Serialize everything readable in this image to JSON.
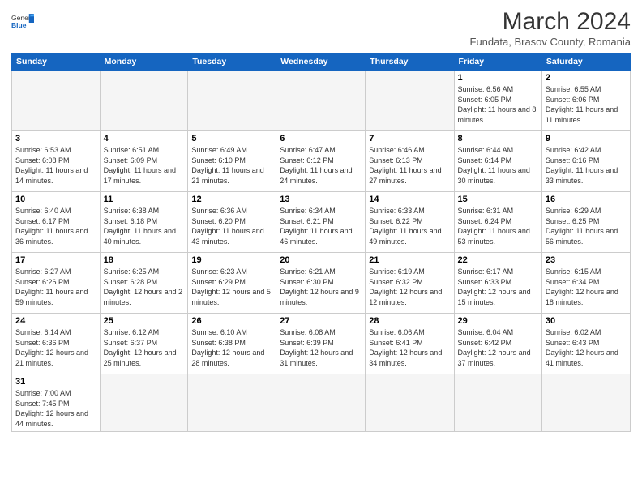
{
  "header": {
    "logo_general": "General",
    "logo_blue": "Blue",
    "month_year": "March 2024",
    "location": "Fundata, Brasov County, Romania"
  },
  "weekdays": [
    "Sunday",
    "Monday",
    "Tuesday",
    "Wednesday",
    "Thursday",
    "Friday",
    "Saturday"
  ],
  "weeks": [
    [
      {
        "day": "",
        "info": ""
      },
      {
        "day": "",
        "info": ""
      },
      {
        "day": "",
        "info": ""
      },
      {
        "day": "",
        "info": ""
      },
      {
        "day": "",
        "info": ""
      },
      {
        "day": "1",
        "info": "Sunrise: 6:56 AM\nSunset: 6:05 PM\nDaylight: 11 hours and 8 minutes."
      },
      {
        "day": "2",
        "info": "Sunrise: 6:55 AM\nSunset: 6:06 PM\nDaylight: 11 hours and 11 minutes."
      }
    ],
    [
      {
        "day": "3",
        "info": "Sunrise: 6:53 AM\nSunset: 6:08 PM\nDaylight: 11 hours and 14 minutes."
      },
      {
        "day": "4",
        "info": "Sunrise: 6:51 AM\nSunset: 6:09 PM\nDaylight: 11 hours and 17 minutes."
      },
      {
        "day": "5",
        "info": "Sunrise: 6:49 AM\nSunset: 6:10 PM\nDaylight: 11 hours and 21 minutes."
      },
      {
        "day": "6",
        "info": "Sunrise: 6:47 AM\nSunset: 6:12 PM\nDaylight: 11 hours and 24 minutes."
      },
      {
        "day": "7",
        "info": "Sunrise: 6:46 AM\nSunset: 6:13 PM\nDaylight: 11 hours and 27 minutes."
      },
      {
        "day": "8",
        "info": "Sunrise: 6:44 AM\nSunset: 6:14 PM\nDaylight: 11 hours and 30 minutes."
      },
      {
        "day": "9",
        "info": "Sunrise: 6:42 AM\nSunset: 6:16 PM\nDaylight: 11 hours and 33 minutes."
      }
    ],
    [
      {
        "day": "10",
        "info": "Sunrise: 6:40 AM\nSunset: 6:17 PM\nDaylight: 11 hours and 36 minutes."
      },
      {
        "day": "11",
        "info": "Sunrise: 6:38 AM\nSunset: 6:18 PM\nDaylight: 11 hours and 40 minutes."
      },
      {
        "day": "12",
        "info": "Sunrise: 6:36 AM\nSunset: 6:20 PM\nDaylight: 11 hours and 43 minutes."
      },
      {
        "day": "13",
        "info": "Sunrise: 6:34 AM\nSunset: 6:21 PM\nDaylight: 11 hours and 46 minutes."
      },
      {
        "day": "14",
        "info": "Sunrise: 6:33 AM\nSunset: 6:22 PM\nDaylight: 11 hours and 49 minutes."
      },
      {
        "day": "15",
        "info": "Sunrise: 6:31 AM\nSunset: 6:24 PM\nDaylight: 11 hours and 53 minutes."
      },
      {
        "day": "16",
        "info": "Sunrise: 6:29 AM\nSunset: 6:25 PM\nDaylight: 11 hours and 56 minutes."
      }
    ],
    [
      {
        "day": "17",
        "info": "Sunrise: 6:27 AM\nSunset: 6:26 PM\nDaylight: 11 hours and 59 minutes."
      },
      {
        "day": "18",
        "info": "Sunrise: 6:25 AM\nSunset: 6:28 PM\nDaylight: 12 hours and 2 minutes."
      },
      {
        "day": "19",
        "info": "Sunrise: 6:23 AM\nSunset: 6:29 PM\nDaylight: 12 hours and 5 minutes."
      },
      {
        "day": "20",
        "info": "Sunrise: 6:21 AM\nSunset: 6:30 PM\nDaylight: 12 hours and 9 minutes."
      },
      {
        "day": "21",
        "info": "Sunrise: 6:19 AM\nSunset: 6:32 PM\nDaylight: 12 hours and 12 minutes."
      },
      {
        "day": "22",
        "info": "Sunrise: 6:17 AM\nSunset: 6:33 PM\nDaylight: 12 hours and 15 minutes."
      },
      {
        "day": "23",
        "info": "Sunrise: 6:15 AM\nSunset: 6:34 PM\nDaylight: 12 hours and 18 minutes."
      }
    ],
    [
      {
        "day": "24",
        "info": "Sunrise: 6:14 AM\nSunset: 6:36 PM\nDaylight: 12 hours and 21 minutes."
      },
      {
        "day": "25",
        "info": "Sunrise: 6:12 AM\nSunset: 6:37 PM\nDaylight: 12 hours and 25 minutes."
      },
      {
        "day": "26",
        "info": "Sunrise: 6:10 AM\nSunset: 6:38 PM\nDaylight: 12 hours and 28 minutes."
      },
      {
        "day": "27",
        "info": "Sunrise: 6:08 AM\nSunset: 6:39 PM\nDaylight: 12 hours and 31 minutes."
      },
      {
        "day": "28",
        "info": "Sunrise: 6:06 AM\nSunset: 6:41 PM\nDaylight: 12 hours and 34 minutes."
      },
      {
        "day": "29",
        "info": "Sunrise: 6:04 AM\nSunset: 6:42 PM\nDaylight: 12 hours and 37 minutes."
      },
      {
        "day": "30",
        "info": "Sunrise: 6:02 AM\nSunset: 6:43 PM\nDaylight: 12 hours and 41 minutes."
      }
    ],
    [
      {
        "day": "31",
        "info": "Sunrise: 7:00 AM\nSunset: 7:45 PM\nDaylight: 12 hours and 44 minutes."
      },
      {
        "day": "",
        "info": ""
      },
      {
        "day": "",
        "info": ""
      },
      {
        "day": "",
        "info": ""
      },
      {
        "day": "",
        "info": ""
      },
      {
        "day": "",
        "info": ""
      },
      {
        "day": "",
        "info": ""
      }
    ]
  ]
}
